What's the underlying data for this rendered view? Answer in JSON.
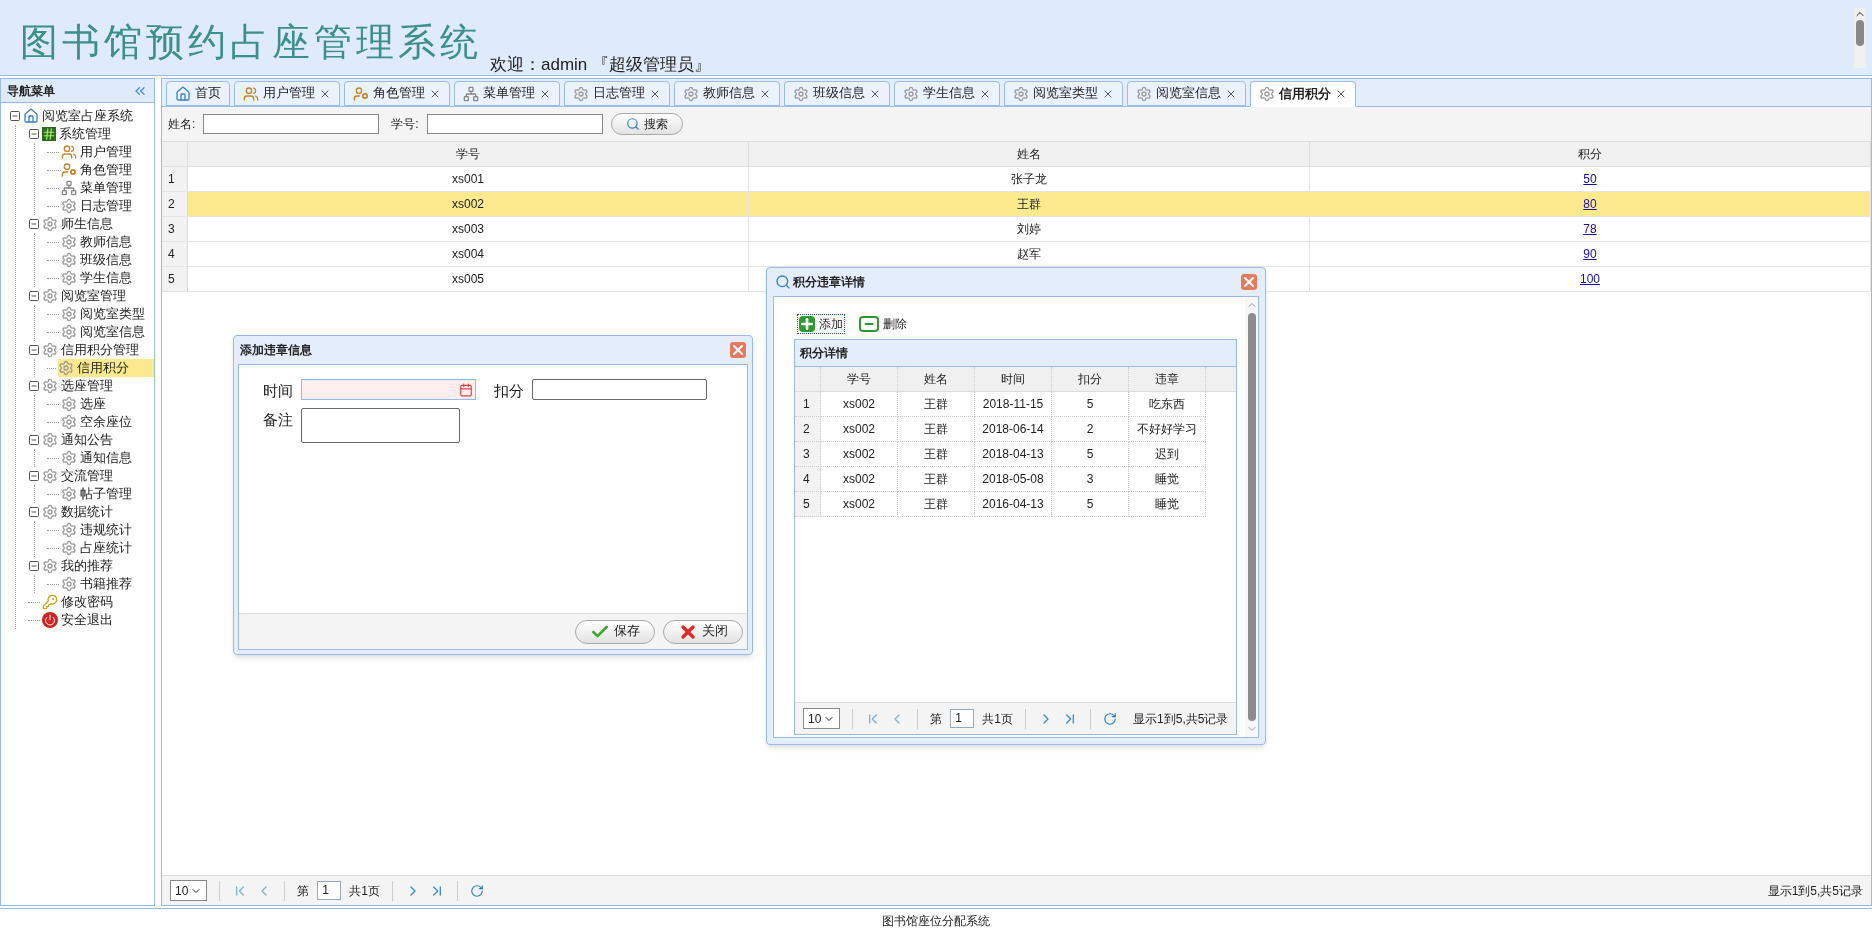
{
  "header": {
    "title": "图书馆预约占座管理系统",
    "welcome": "欢迎：admin 『超级管理员』"
  },
  "sidebar": {
    "title": "导航菜单",
    "tree": [
      {
        "label": "阅览室占座系统",
        "expanded": true,
        "selected": false,
        "children": [
          {
            "label": "系统管理",
            "expanded": true,
            "selected": false,
            "children": [
              {
                "label": "用户管理",
                "selected": false
              },
              {
                "label": "角色管理",
                "selected": false
              },
              {
                "label": "菜单管理",
                "selected": false
              },
              {
                "label": "日志管理",
                "selected": false
              }
            ]
          },
          {
            "label": "师生信息",
            "expanded": true,
            "selected": false,
            "children": [
              {
                "label": "教师信息",
                "selected": false
              },
              {
                "label": "班级信息",
                "selected": false
              },
              {
                "label": "学生信息",
                "selected": false
              }
            ]
          },
          {
            "label": "阅览室管理",
            "expanded": true,
            "selected": false,
            "children": [
              {
                "label": "阅览室类型",
                "selected": false
              },
              {
                "label": "阅览室信息",
                "selected": false
              }
            ]
          },
          {
            "label": "信用积分管理",
            "expanded": true,
            "selected": false,
            "children": [
              {
                "label": "信用积分",
                "selected": true
              }
            ]
          },
          {
            "label": "选座管理",
            "expanded": true,
            "selected": false,
            "children": [
              {
                "label": "选座",
                "selected": false
              },
              {
                "label": "空余座位",
                "selected": false
              }
            ]
          },
          {
            "label": "通知公告",
            "expanded": true,
            "selected": false,
            "children": [
              {
                "label": "通知信息",
                "selected": false
              }
            ]
          },
          {
            "label": "交流管理",
            "expanded": true,
            "selected": false,
            "children": [
              {
                "label": "帖子管理",
                "selected": false
              }
            ]
          },
          {
            "label": "数据统计",
            "expanded": true,
            "selected": false,
            "children": [
              {
                "label": "违规统计",
                "selected": false
              },
              {
                "label": "占座统计",
                "selected": false
              }
            ]
          },
          {
            "label": "我的推荐",
            "expanded": true,
            "selected": false,
            "children": [
              {
                "label": "书籍推荐",
                "selected": false
              }
            ]
          },
          {
            "label": "修改密码",
            "selected": false
          },
          {
            "label": "安全退出",
            "selected": false
          }
        ]
      }
    ]
  },
  "tabs": [
    {
      "label": "首页",
      "selected": false,
      "closable": false
    },
    {
      "label": "用户管理",
      "selected": false,
      "closable": true
    },
    {
      "label": "角色管理",
      "selected": false,
      "closable": true
    },
    {
      "label": "菜单管理",
      "selected": false,
      "closable": true
    },
    {
      "label": "日志管理",
      "selected": false,
      "closable": true
    },
    {
      "label": "教师信息",
      "selected": false,
      "closable": true
    },
    {
      "label": "班级信息",
      "selected": false,
      "closable": true
    },
    {
      "label": "学生信息",
      "selected": false,
      "closable": true
    },
    {
      "label": "阅览室类型",
      "selected": false,
      "closable": true
    },
    {
      "label": "阅览室信息",
      "selected": false,
      "closable": true
    },
    {
      "label": "信用积分",
      "selected": true,
      "closable": true
    }
  ],
  "search": {
    "fields": [
      {
        "label": "姓名:"
      },
      {
        "label": "学号:"
      }
    ],
    "button": "搜索"
  },
  "grid": {
    "columns": [
      "学号",
      "姓名",
      "积分"
    ],
    "rows": [
      {
        "index": "1",
        "id": "xs001",
        "name": "张子龙",
        "score": "50",
        "selected": false
      },
      {
        "index": "2",
        "id": "xs002",
        "name": "王群",
        "score": "80",
        "selected": true
      },
      {
        "index": "3",
        "id": "xs003",
        "name": "刘婷",
        "score": "78",
        "selected": false
      },
      {
        "index": "4",
        "id": "xs004",
        "name": "赵军",
        "score": "90",
        "selected": false
      },
      {
        "index": "5",
        "id": "xs005",
        "score": "100",
        "selected": false
      }
    ]
  },
  "pager": {
    "page_size": "10",
    "page_label": "第",
    "page": "1",
    "total_pages": "共1页",
    "summary": "显示1到5,共5记录"
  },
  "footer": "图书馆座位分配系统",
  "add_dialog": {
    "title": "添加违章信息",
    "fields": [
      {
        "label": "时间",
        "kind": "date",
        "invalid": true
      },
      {
        "label": "扣分",
        "kind": "text",
        "invalid": false
      },
      {
        "label": "备注",
        "kind": "textarea",
        "invalid": false
      }
    ],
    "buttons": [
      {
        "label": "保存",
        "kind": "save"
      },
      {
        "label": "关闭",
        "kind": "close"
      }
    ]
  },
  "detail_dialog": {
    "title": "积分违章详情",
    "toolbar": [
      {
        "label": "添加",
        "kind": "add",
        "focused": true
      },
      {
        "label": "删除",
        "kind": "remove",
        "focused": false
      }
    ],
    "panel_title": "积分详情",
    "columns": [
      "学号",
      "姓名",
      "时间",
      "扣分",
      "违章"
    ],
    "rows": [
      {
        "index": "1",
        "cells": [
          "xs002",
          "王群",
          "2018-11-15",
          "5",
          "吃东西"
        ]
      },
      {
        "index": "2",
        "cells": [
          "xs002",
          "王群",
          "2018-06-14",
          "2",
          "不好好学习"
        ]
      },
      {
        "index": "3",
        "cells": [
          "xs002",
          "王群",
          "2018-04-13",
          "5",
          "迟到"
        ]
      },
      {
        "index": "4",
        "cells": [
          "xs002",
          "王群",
          "2018-05-08",
          "3",
          "睡觉"
        ]
      },
      {
        "index": "5",
        "cells": [
          "xs002",
          "王群",
          "2016-04-13",
          "5",
          "睡觉"
        ]
      }
    ],
    "pager": {
      "page_size": "10",
      "page_label": "第",
      "page": "1",
      "total_pages": "共1页",
      "summary": "显示1到5,共5记录"
    }
  }
}
